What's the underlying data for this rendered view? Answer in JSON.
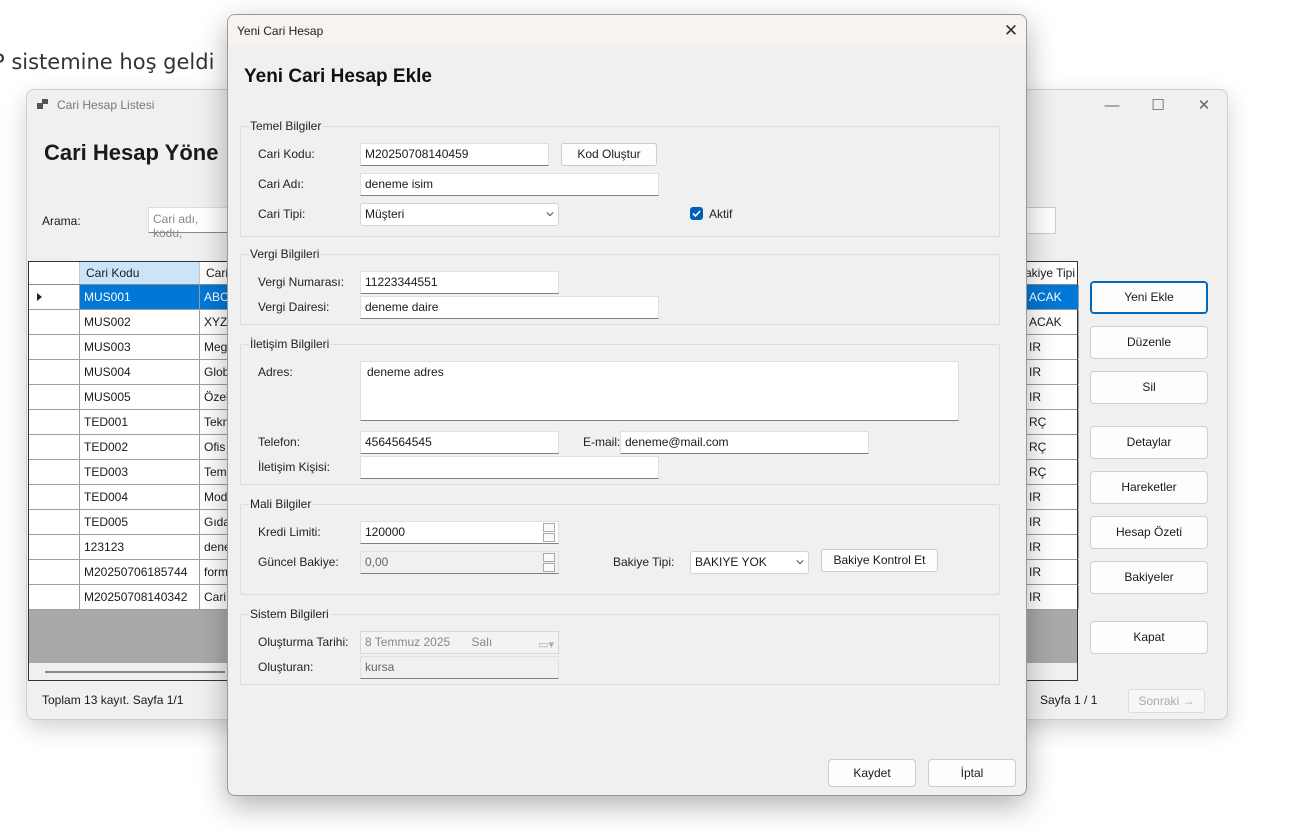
{
  "background_text": "P sistemine hoş geldi",
  "list_window": {
    "title": "Cari Hesap Listesi",
    "heading": "Cari Hesap Yöne",
    "search_label": "Arama:",
    "search_placeholder": "Cari adı, kodu,",
    "columns": [
      "Cari Kodu",
      "Cari",
      "akiye Tipi"
    ],
    "rows": [
      {
        "code": "MUS001",
        "name": "ABC",
        "type": "ACAK"
      },
      {
        "code": "MUS002",
        "name": "XYZ",
        "type": "ACAK"
      },
      {
        "code": "MUS003",
        "name": "Meg",
        "type": "IR"
      },
      {
        "code": "MUS004",
        "name": "Glob",
        "type": "IR"
      },
      {
        "code": "MUS005",
        "name": "Özel",
        "type": "IR"
      },
      {
        "code": "TED001",
        "name": "Tekn",
        "type": "RÇ"
      },
      {
        "code": "TED002",
        "name": "Ofis",
        "type": "RÇ"
      },
      {
        "code": "TED003",
        "name": "Temi",
        "type": "RÇ"
      },
      {
        "code": "TED004",
        "name": "Mod",
        "type": "IR"
      },
      {
        "code": "TED005",
        "name": "Gıda",
        "type": "IR"
      },
      {
        "code": "123123",
        "name": "dene",
        "type": "IR"
      },
      {
        "code": "M20250706185744",
        "name": "form",
        "type": "IR"
      },
      {
        "code": "M20250708140342",
        "name": "Cari",
        "type": "IR"
      }
    ],
    "buttons": [
      "Yeni Ekle",
      "Düzenle",
      "Sil",
      "Detaylar",
      "Hareketler",
      "Hesap Özeti",
      "Bakiyeler",
      "Kapat"
    ],
    "footer_total": "Toplam 13 kayıt. Sayfa 1/1",
    "footer_page": "Sayfa 1 / 1",
    "next_label": "Sonraki →"
  },
  "dialog": {
    "title": "Yeni Cari Hesap",
    "heading": "Yeni Cari Hesap Ekle",
    "temel": {
      "legend": "Temel Bilgiler",
      "code_label": "Cari Kodu:",
      "code_value": "M20250708140459",
      "generate_label": "Kod Oluştur",
      "name_label": "Cari Adı:",
      "name_value": "deneme isim",
      "type_label": "Cari Tipi:",
      "type_value": "Müşteri",
      "active_label": "Aktif",
      "active_checked": true
    },
    "vergi": {
      "legend": "Vergi Bilgileri",
      "no_label": "Vergi Numarası:",
      "no_value": "11223344551",
      "office_label": "Vergi Dairesi:",
      "office_value": "deneme daire"
    },
    "iletisim": {
      "legend": "İletişim Bilgileri",
      "address_label": "Adres:",
      "address_value": "deneme adres",
      "phone_label": "Telefon:",
      "phone_value": "4564564545",
      "email_label": "E-mail:",
      "email_value": "deneme@mail.com",
      "contact_label": "İletişim Kişisi:",
      "contact_value": ""
    },
    "mali": {
      "legend": "Mali Bilgiler",
      "limit_label": "Kredi Limiti:",
      "limit_value": "120000",
      "balance_label": "Güncel Bakiye:",
      "balance_value": "0,00",
      "balance_type_label": "Bakiye Tipi:",
      "balance_type_value": "BAKIYE YOK",
      "check_label": "Bakiye Kontrol Et"
    },
    "sistem": {
      "legend": "Sistem Bilgileri",
      "created_label": "Oluşturma Tarihi:",
      "created_date": "8 Temmuz 2025",
      "created_day": "Salı",
      "creator_label": "Oluşturan:",
      "creator_value": "kursa"
    },
    "save_label": "Kaydet",
    "cancel_label": "İptal"
  },
  "colors": {
    "accent": "#0078d7",
    "checkbox": "#005fb8"
  }
}
